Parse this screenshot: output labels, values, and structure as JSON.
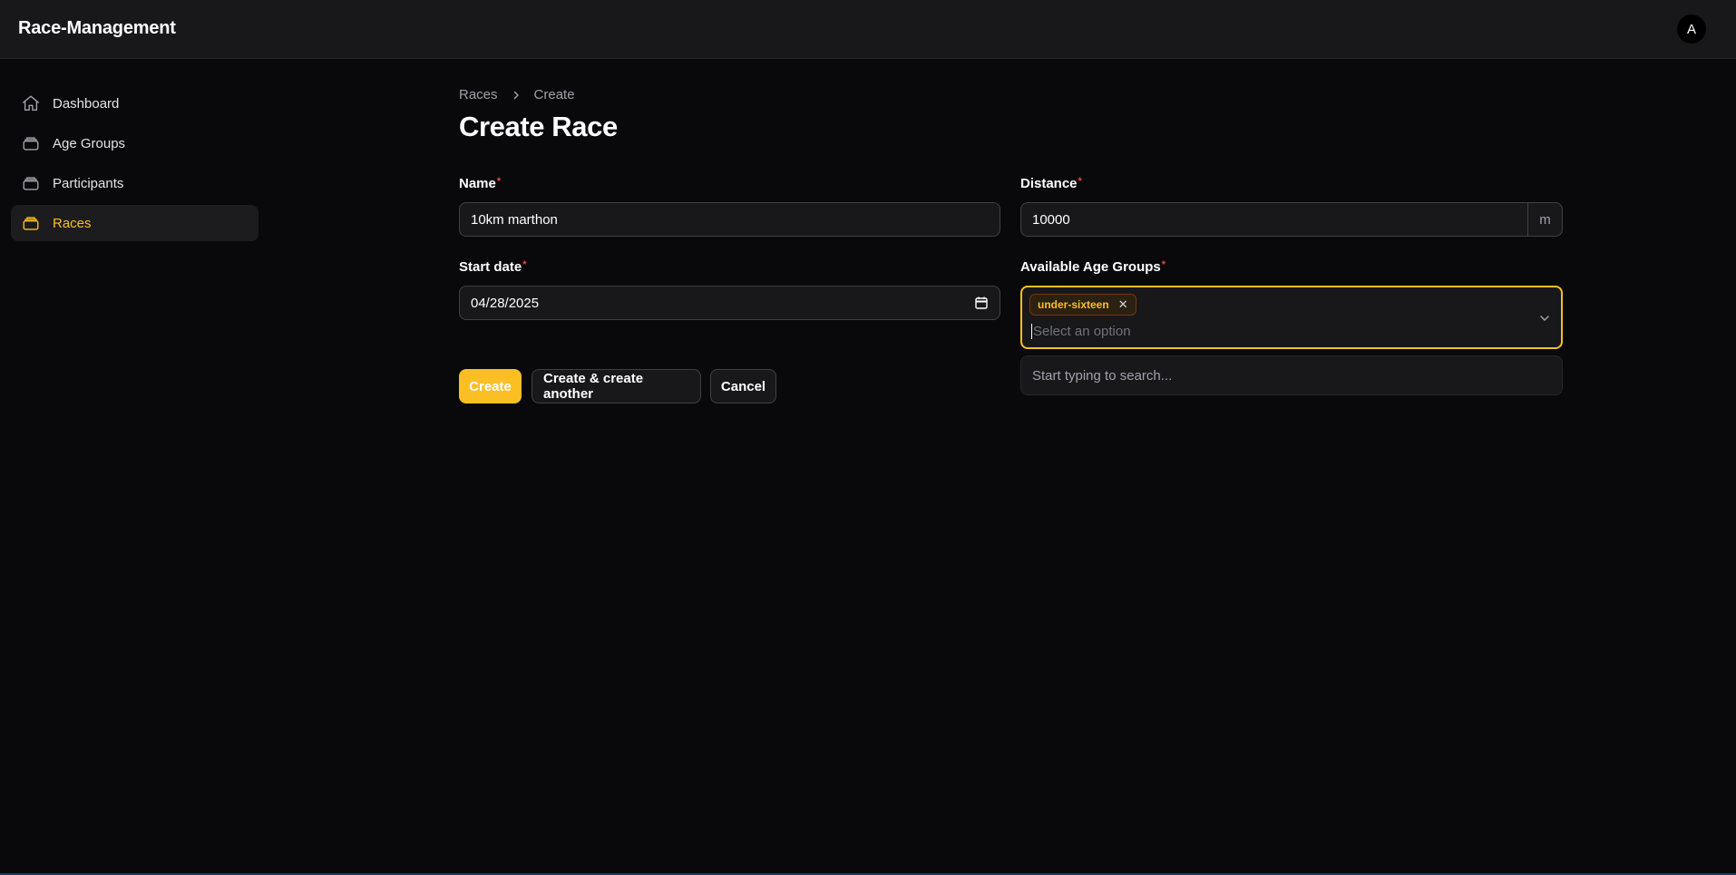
{
  "app": {
    "title": "Race-Management",
    "avatar_initial": "A"
  },
  "sidebar": {
    "items": [
      {
        "label": "Dashboard",
        "icon": "home-icon",
        "active": false
      },
      {
        "label": "Age Groups",
        "icon": "stack-icon",
        "active": false
      },
      {
        "label": "Participants",
        "icon": "stack-icon",
        "active": false
      },
      {
        "label": "Races",
        "icon": "stack-icon",
        "active": true
      }
    ]
  },
  "breadcrumb": {
    "items": [
      "Races",
      "Create"
    ]
  },
  "page": {
    "title": "Create Race"
  },
  "form": {
    "name": {
      "label": "Name",
      "required_mark": "*",
      "value": "10km marthon"
    },
    "distance": {
      "label": "Distance",
      "required_mark": "*",
      "value": "10000",
      "suffix": "m"
    },
    "start_date": {
      "label": "Start date",
      "required_mark": "*",
      "value": "04/28/2025"
    },
    "age_groups": {
      "label": "Available Age Groups",
      "required_mark": "*",
      "selected": [
        "under-sixteen"
      ],
      "remove_glyph": "✕",
      "placeholder": "Select an option",
      "dropdown_text": "Start typing to search..."
    }
  },
  "actions": {
    "create": "Create",
    "create_another": "Create & create another",
    "cancel": "Cancel"
  },
  "colors": {
    "accent": "#fbbf24",
    "background": "#09090b",
    "surface": "#18181b",
    "required": "#ef4444"
  }
}
